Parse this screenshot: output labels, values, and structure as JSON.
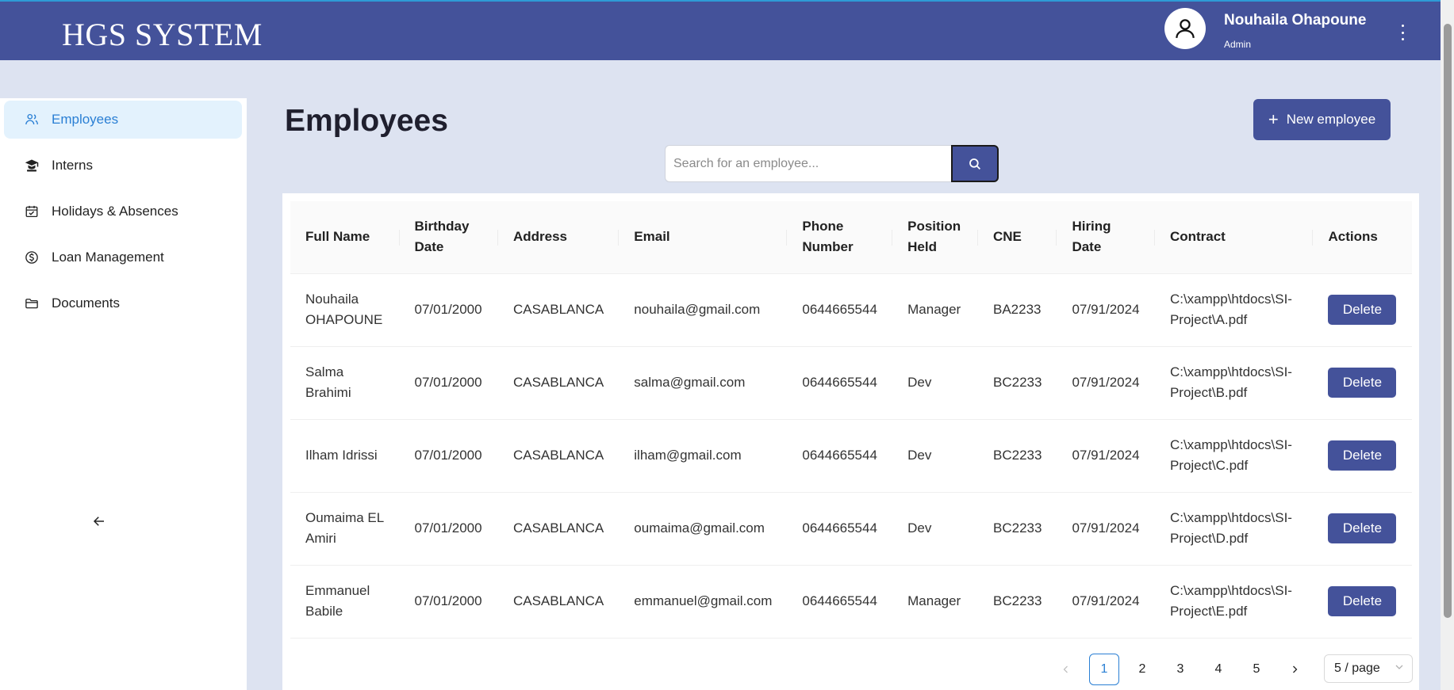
{
  "app": {
    "title": "HGS SYSTEM"
  },
  "user": {
    "name": "Nouhaila Ohapoune",
    "role": "Admin"
  },
  "sidebar": {
    "items": [
      {
        "label": "Employees",
        "icon": "users-icon",
        "active": true
      },
      {
        "label": "Interns",
        "icon": "graduate-icon",
        "active": false
      },
      {
        "label": "Holidays & Absences",
        "icon": "calendar-icon",
        "active": false
      },
      {
        "label": "Loan Management",
        "icon": "dollar-circle-icon",
        "active": false
      },
      {
        "label": "Documents",
        "icon": "folder-icon",
        "active": false
      }
    ]
  },
  "main": {
    "title": "Employees",
    "new_button_label": "New employee",
    "search_placeholder": "Search for an employee..."
  },
  "table": {
    "columns": [
      "Full Name",
      "Birthday Date",
      "Address",
      "Email",
      "Phone Number",
      "Position Held",
      "CNE",
      "Hiring Date",
      "Contract",
      "Actions"
    ],
    "rows": [
      {
        "full_name": "Nouhaila OHAPOUNE",
        "birthday": "07/01/2000",
        "address": "CASABLANCA",
        "email": "nouhaila@gmail.com",
        "phone": "0644665544",
        "position": "Manager",
        "cne": "BA2233",
        "hiring_date": "07/91/2024",
        "contract": "C:\\xampp\\htdocs\\SI-Project\\A.pdf",
        "action_label": "Delete"
      },
      {
        "full_name": "Salma Brahimi",
        "birthday": "07/01/2000",
        "address": "CASABLANCA",
        "email": "salma@gmail.com",
        "phone": "0644665544",
        "position": "Dev",
        "cne": "BC2233",
        "hiring_date": "07/91/2024",
        "contract": "C:\\xampp\\htdocs\\SI-Project\\B.pdf",
        "action_label": "Delete"
      },
      {
        "full_name": "Ilham Idrissi",
        "birthday": "07/01/2000",
        "address": "CASABLANCA",
        "email": "ilham@gmail.com",
        "phone": "0644665544",
        "position": "Dev",
        "cne": "BC2233",
        "hiring_date": "07/91/2024",
        "contract": "C:\\xampp\\htdocs\\SI-Project\\C.pdf",
        "action_label": "Delete"
      },
      {
        "full_name": "Oumaima EL Amiri",
        "birthday": "07/01/2000",
        "address": "CASABLANCA",
        "email": "oumaima@gmail.com",
        "phone": "0644665544",
        "position": "Dev",
        "cne": "BC2233",
        "hiring_date": "07/91/2024",
        "contract": "C:\\xampp\\htdocs\\SI-Project\\D.pdf",
        "action_label": "Delete"
      },
      {
        "full_name": "Emmanuel Babile",
        "birthday": "07/01/2000",
        "address": "CASABLANCA",
        "email": "emmanuel@gmail.com",
        "phone": "0644665544",
        "position": "Manager",
        "cne": "BC2233",
        "hiring_date": "07/91/2024",
        "contract": "C:\\xampp\\htdocs\\SI-Project\\E.pdf",
        "action_label": "Delete"
      }
    ]
  },
  "pagination": {
    "pages": [
      "1",
      "2",
      "3",
      "4",
      "5"
    ],
    "current": "1",
    "page_size": "5 / page"
  },
  "colors": {
    "brand": "#44529a",
    "accent": "#2a7fd4",
    "active_nav_bg": "#e3f2fd",
    "page_bg": "#dde3f1"
  }
}
